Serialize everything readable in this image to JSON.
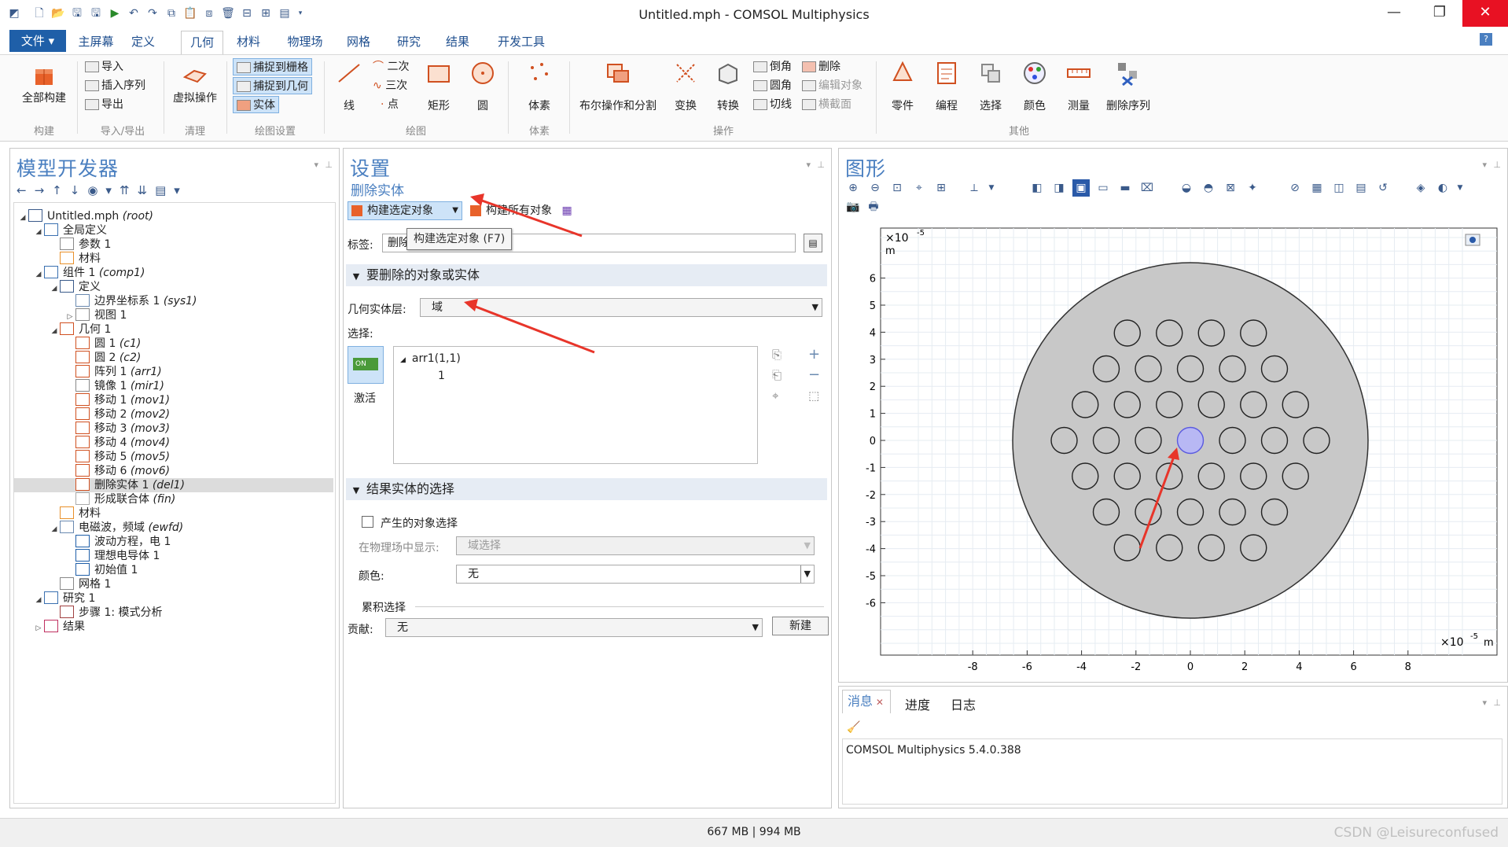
{
  "window": {
    "title": "Untitled.mph - COMSOL Multiphysics",
    "minimize": "—",
    "restore": "❐",
    "close": "✕"
  },
  "menu": {
    "file": "文件 ▾",
    "tabs": [
      "主屏幕",
      "定义",
      "几何",
      "材料",
      "物理场",
      "网格",
      "研究",
      "结果",
      "开发工具"
    ],
    "active_tab": "几何",
    "help": "?"
  },
  "ribbon": {
    "build_all": "全部构建",
    "group_build": "构建",
    "import": "导入",
    "insert_sequence": "插入序列",
    "export": "导出",
    "group_import_export": "导入/导出",
    "virtual_ops": "虚拟操作",
    "group_cleanup": "清理",
    "snap_grid": "捕捉到栅格",
    "snap_geom": "捕捉到几何",
    "solid": "实体",
    "group_draw_settings": "绘图设置",
    "line": "线",
    "quadratic": "二次",
    "cubic": "三次",
    "point": "点",
    "rectangle": "矩形",
    "circle": "圆",
    "group_draw": "绘图",
    "primitives": "体素",
    "group_primitives": "体素",
    "boolean_partition": "布尔操作和分割",
    "transforms": "变换",
    "conversions": "转换",
    "chamfer": "倒角",
    "fillet": "圆角",
    "tangent": "切线",
    "delete": "删除",
    "edit_object": "编辑对象",
    "cross_section": "横截面",
    "group_operations": "操作",
    "parts": "零件",
    "programming": "编程",
    "selections": "选择",
    "colors": "颜色",
    "measure": "测量",
    "delete_sequence": "删除序列",
    "group_other": "其他"
  },
  "model_builder": {
    "title": "模型开发器",
    "tree": [
      {
        "label": "Untitled.mph",
        "tag": "(root)",
        "level": 0,
        "toggle": "◢",
        "icon": "root-icon"
      },
      {
        "label": "全局定义",
        "tag": "",
        "level": 1,
        "toggle": "◢",
        "icon": "globe-icon"
      },
      {
        "label": "参数 1",
        "tag": "",
        "level": 2,
        "toggle": "",
        "icon": "parameter-icon"
      },
      {
        "label": "材料",
        "tag": "",
        "level": 2,
        "toggle": "",
        "icon": "materials-icon"
      },
      {
        "label": "组件 1",
        "tag": "(comp1)",
        "level": 1,
        "toggle": "◢",
        "icon": "component-icon"
      },
      {
        "label": "定义",
        "tag": "",
        "level": 2,
        "toggle": "◢",
        "icon": "definitions-icon"
      },
      {
        "label": "边界坐标系 1",
        "tag": "(sys1)",
        "level": 3,
        "toggle": "",
        "icon": "coordinate-system-icon"
      },
      {
        "label": "视图 1",
        "tag": "",
        "level": 3,
        "toggle": "▷",
        "icon": "view-icon"
      },
      {
        "label": "几何 1",
        "tag": "",
        "level": 2,
        "toggle": "◢",
        "icon": "geometry-icon"
      },
      {
        "label": "圆 1",
        "tag": "(c1)",
        "level": 3,
        "toggle": "",
        "icon": "circle-icon"
      },
      {
        "label": "圆 2",
        "tag": "(c2)",
        "level": 3,
        "toggle": "",
        "icon": "circle-icon"
      },
      {
        "label": "阵列 1",
        "tag": "(arr1)",
        "level": 3,
        "toggle": "",
        "icon": "array-icon"
      },
      {
        "label": "镜像 1",
        "tag": "(mir1)",
        "level": 3,
        "toggle": "",
        "icon": "mirror-icon"
      },
      {
        "label": "移动 1",
        "tag": "(mov1)",
        "level": 3,
        "toggle": "",
        "icon": "move-icon"
      },
      {
        "label": "移动 2",
        "tag": "(mov2)",
        "level": 3,
        "toggle": "",
        "icon": "move-icon"
      },
      {
        "label": "移动 3",
        "tag": "(mov3)",
        "level": 3,
        "toggle": "",
        "icon": "move-icon"
      },
      {
        "label": "移动 4",
        "tag": "(mov4)",
        "level": 3,
        "toggle": "",
        "icon": "move-icon"
      },
      {
        "label": "移动 5",
        "tag": "(mov5)",
        "level": 3,
        "toggle": "",
        "icon": "move-icon"
      },
      {
        "label": "移动 6",
        "tag": "(mov6)",
        "level": 3,
        "toggle": "",
        "icon": "move-icon"
      },
      {
        "label": "删除实体 1",
        "tag": "(del1)",
        "level": 3,
        "toggle": "",
        "icon": "delete-entities-icon",
        "selected": true
      },
      {
        "label": "形成联合体",
        "tag": "(fin)",
        "level": 3,
        "toggle": "",
        "icon": "form-union-icon"
      },
      {
        "label": "材料",
        "tag": "",
        "level": 2,
        "toggle": "",
        "icon": "materials-icon"
      },
      {
        "label": "电磁波，频域",
        "tag": "(ewfd)",
        "level": 2,
        "toggle": "◢",
        "icon": "physics-icon"
      },
      {
        "label": "波动方程，电 1",
        "tag": "",
        "level": 3,
        "toggle": "",
        "icon": "wave-equation-icon"
      },
      {
        "label": "理想电导体 1",
        "tag": "",
        "level": 3,
        "toggle": "",
        "icon": "pec-icon"
      },
      {
        "label": "初始值 1",
        "tag": "",
        "level": 3,
        "toggle": "",
        "icon": "initial-values-icon"
      },
      {
        "label": "网格 1",
        "tag": "",
        "level": 2,
        "toggle": "",
        "icon": "mesh-icon"
      },
      {
        "label": "研究 1",
        "tag": "",
        "level": 1,
        "toggle": "◢",
        "icon": "study-icon"
      },
      {
        "label": "步骤 1: 模式分析",
        "tag": "",
        "level": 2,
        "toggle": "",
        "icon": "study-step-icon"
      },
      {
        "label": "结果",
        "tag": "",
        "level": 1,
        "toggle": "▷",
        "icon": "results-icon"
      }
    ]
  },
  "settings": {
    "title": "设置",
    "subtitle": "删除实体",
    "build_selected": "构建选定对象",
    "build_all_objects": "构建所有对象",
    "tooltip": "构建选定对象 (F7)",
    "label_caption": "标签:",
    "label_value": "删除实体 1",
    "section1": "要删除的对象或实体",
    "geom_level_caption": "几何实体层:",
    "geom_level_value": "域",
    "selection_caption": "选择:",
    "active_toggle": "ON",
    "active_label": "激活",
    "selection_items": [
      "arr1(1,1)",
      "1"
    ],
    "section2": "结果实体的选择",
    "resulting_checkbox": "产生的对象选择",
    "show_in_physics_caption": "在物理场中显示:",
    "show_in_physics_value": "域选择",
    "color_caption": "颜色:",
    "color_value": "无",
    "cumulative_caption": "累积选择",
    "contribute_caption": "贡献:",
    "contribute_value": "无",
    "new_button": "新建"
  },
  "graphics": {
    "title": "图形",
    "scale_top": "×10",
    "scale_exp": "-5",
    "unit": "m",
    "scale_right": "×10",
    "x_ticks": [
      "-8",
      "-6",
      "-4",
      "-2",
      "0",
      "2",
      "4",
      "6",
      "8"
    ],
    "y_ticks": [
      "6",
      "5",
      "4",
      "3",
      "2",
      "1",
      "0",
      "-1",
      "-2",
      "-3",
      "-4",
      "-5",
      "-6"
    ]
  },
  "messages": {
    "tabs": [
      "消息",
      "进度",
      "日志"
    ],
    "text": "COMSOL Multiphysics 5.4.0.388"
  },
  "status": {
    "memory": "667 MB | 994 MB",
    "watermark": "CSDN @Leisureconfused"
  },
  "colors": {
    "accent": "#4a7fc0",
    "selected_domain": "#b8b8f4",
    "geometry_fill": "#c8c8c8",
    "arrow": "#e8352a"
  }
}
